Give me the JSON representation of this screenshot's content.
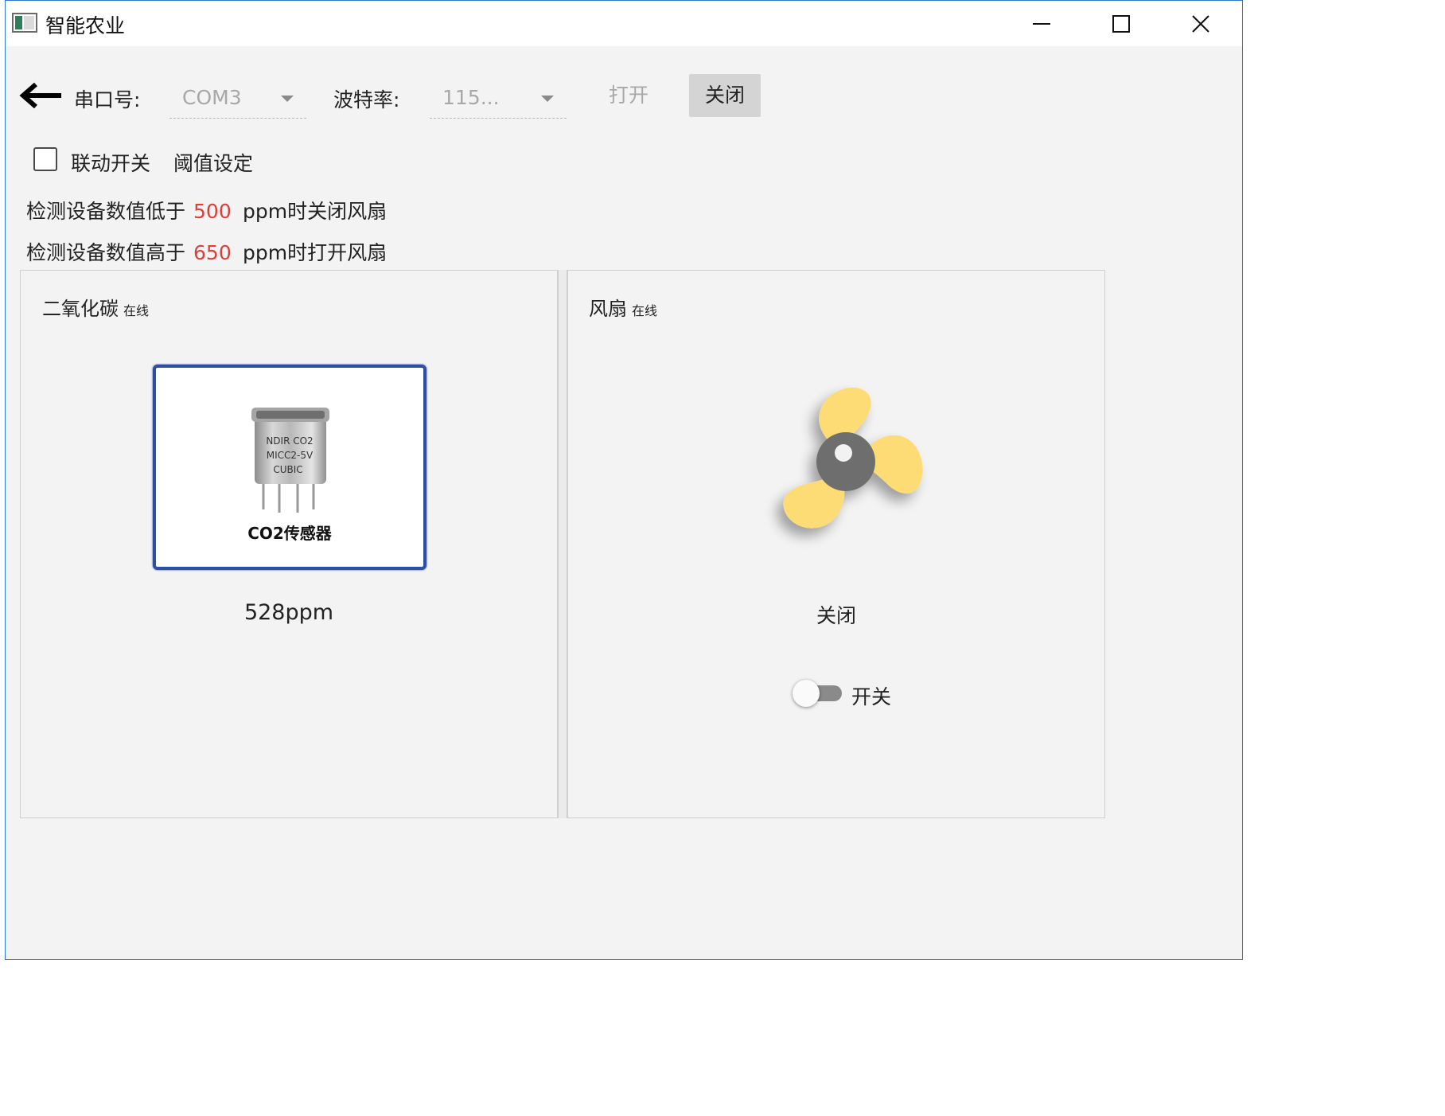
{
  "window": {
    "title": "智能农业"
  },
  "toolbar": {
    "port_label": "串口号:",
    "port_value": "COM3",
    "baud_label": "波特率:",
    "baud_value": "115...",
    "open_label": "打开",
    "close_label": "关闭"
  },
  "options": {
    "linkage_label": "联动开关",
    "linkage_checked": false,
    "threshold_label": "阈值设定"
  },
  "rules": {
    "low_prefix": "检测设备数值低于",
    "low_value": "500",
    "low_suffix": "ppm时关闭风扇",
    "high_prefix": "检测设备数值高于",
    "high_value": "650",
    "high_suffix": "ppm时打开风扇"
  },
  "co2_panel": {
    "title": "二氧化碳",
    "status": "在线",
    "image_caption": "CO2传感器",
    "image_text": [
      "NDIR CO2",
      "MICC2-5V",
      "CUBIC"
    ],
    "reading": "528ppm"
  },
  "fan_panel": {
    "title": "风扇",
    "status": "在线",
    "state": "关闭",
    "switch_label": "开关",
    "switch_on": false
  },
  "colors": {
    "threshold_value": "#d9413a",
    "fan_blade": "#fddb75",
    "fan_hub": "#6e6e6e",
    "card_border": "#2d4fa0"
  }
}
